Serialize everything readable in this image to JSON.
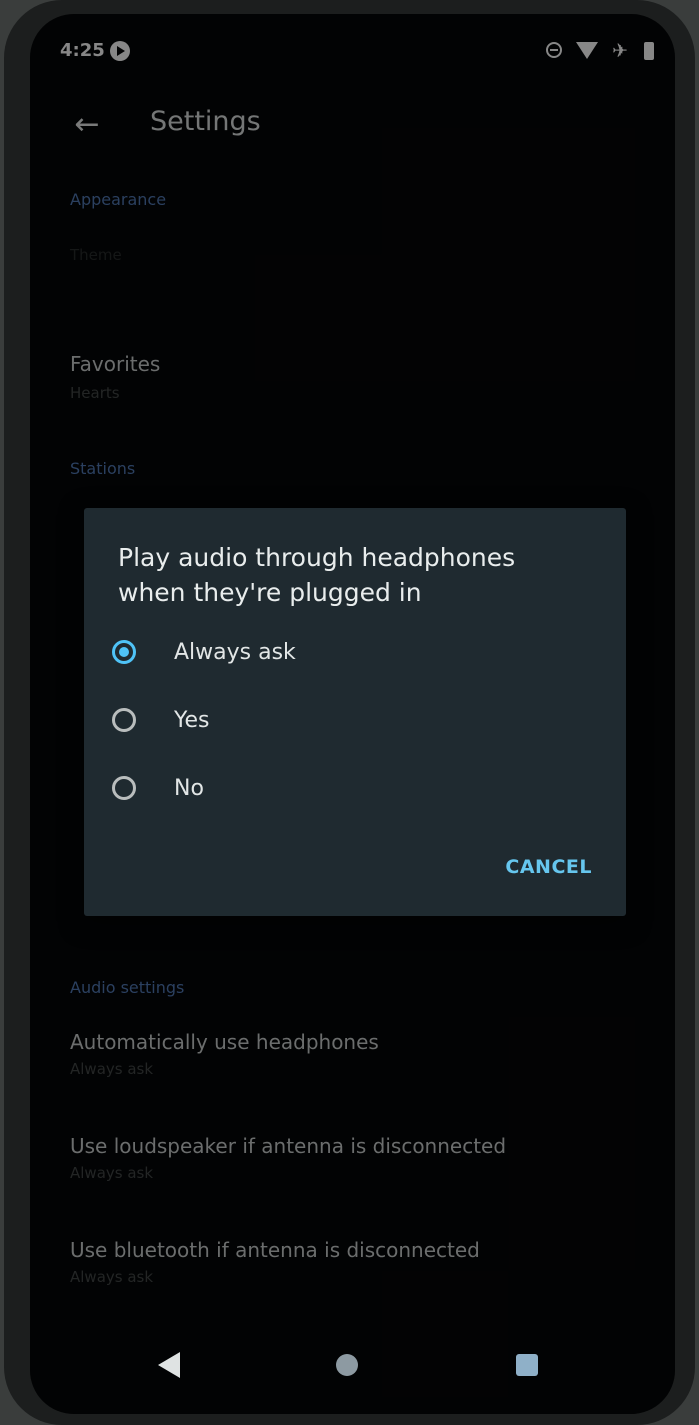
{
  "status_bar": {
    "time": "4:25"
  },
  "app_bar": {
    "title": "Settings"
  },
  "settings": {
    "appearance_header": "Appearance",
    "theme_title": "Theme",
    "favorites_title": "Favorites",
    "favorites_sub": "Hearts",
    "stations_header": "Stations",
    "audio_header": "Audio settings",
    "auto_headphones_title": "Automatically use headphones",
    "auto_headphones_sub": "Always ask",
    "loudspeaker_title": "Use loudspeaker if antenna is disconnected",
    "loudspeaker_sub": "Always ask",
    "bluetooth_title": "Use bluetooth if antenna is disconnected",
    "bluetooth_sub": "Always ask"
  },
  "dialog": {
    "title": "Play audio through headphones when they're plugged in",
    "options": [
      {
        "label": "Always ask",
        "checked": true
      },
      {
        "label": "Yes",
        "checked": false
      },
      {
        "label": "No",
        "checked": false
      }
    ],
    "cancel_label": "CANCEL"
  },
  "colors": {
    "accent": "#4fc3f7",
    "dialog_bg": "#1f2a30",
    "section_header": "#4a6fa6"
  },
  "icons": {
    "status": [
      "media-playing-icon",
      "do-not-disturb-icon",
      "wifi-icon",
      "airplane-mode-icon",
      "battery-icon"
    ],
    "app_bar": "back-arrow-icon",
    "nav": [
      "nav-back-icon",
      "nav-home-icon",
      "nav-recents-icon"
    ]
  }
}
